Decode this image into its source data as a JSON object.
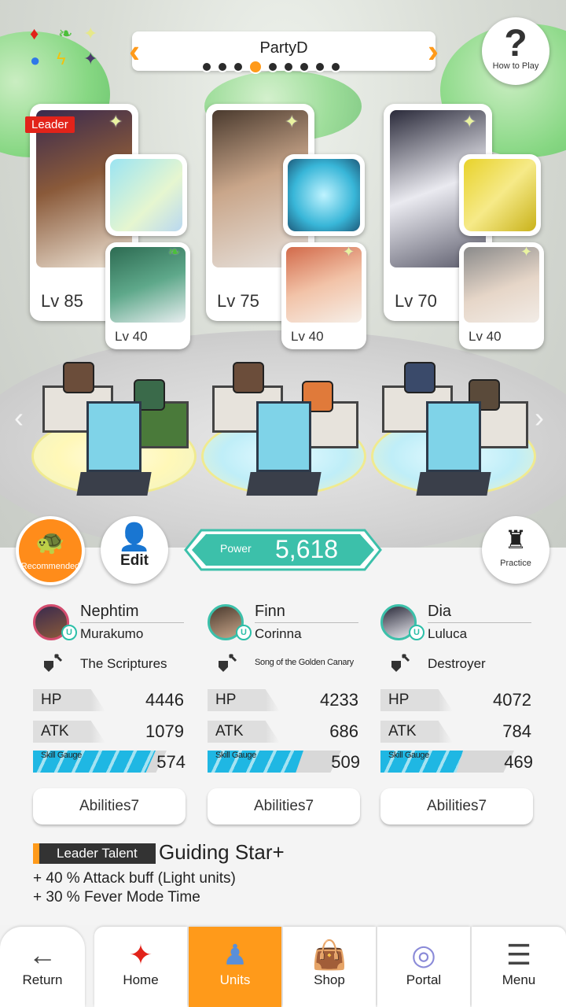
{
  "header": {
    "party_name": "PartyD",
    "page_count": 9,
    "active_page_index": 3
  },
  "howto": {
    "label": "How to Play"
  },
  "units_top": [
    {
      "leader_label": "Leader",
      "main_level": "Lv 85",
      "sub_level": "Lv 40"
    },
    {
      "main_level": "Lv 75",
      "sub_level": "Lv 40"
    },
    {
      "main_level": "Lv 70",
      "sub_level": "Lv 40"
    }
  ],
  "buttons": {
    "recommended": "Recommended",
    "edit": "Edit",
    "practice": "Practice"
  },
  "power": {
    "label": "Power",
    "value": "5,618"
  },
  "units": [
    {
      "name": "Nephtim",
      "sub": "Murakumo",
      "weapon": "The Scriptures",
      "hp_label": "HP",
      "hp": "4446",
      "atk_label": "ATK",
      "atk": "1079",
      "gauge_label": "Skill Gauge",
      "gauge": "574",
      "gauge_fill": 0.92,
      "abilities": "Abilities7"
    },
    {
      "name": "Finn",
      "sub": "Corinna",
      "weapon": "Song of the Golden Canary",
      "hp_label": "HP",
      "hp": "4233",
      "atk_label": "ATK",
      "atk": "686",
      "gauge_label": "Skill Gauge",
      "gauge": "509",
      "gauge_fill": 0.72,
      "abilities": "Abilities7"
    },
    {
      "name": "Dia",
      "sub": "Luluca",
      "weapon": "Destroyer",
      "hp_label": "HP",
      "hp": "4072",
      "atk_label": "ATK",
      "atk": "784",
      "gauge_label": "Skill Gauge",
      "gauge": "469",
      "gauge_fill": 0.62,
      "abilities": "Abilities7"
    }
  ],
  "talent": {
    "tag": "Leader Talent",
    "name": "Guiding Star+",
    "line1": "+ 40 % Attack buff (Light  units)",
    "line2": "+ 30 % Fever Mode Time"
  },
  "nav": {
    "return": "Return",
    "home": "Home",
    "units": "Units",
    "shop": "Shop",
    "portal": "Portal",
    "menu": "Menu"
  },
  "colors": {
    "accent": "#ff9a1a",
    "power": "#3cc0aa",
    "gauge": "#1fb7e3",
    "leader": "#e2231a"
  }
}
